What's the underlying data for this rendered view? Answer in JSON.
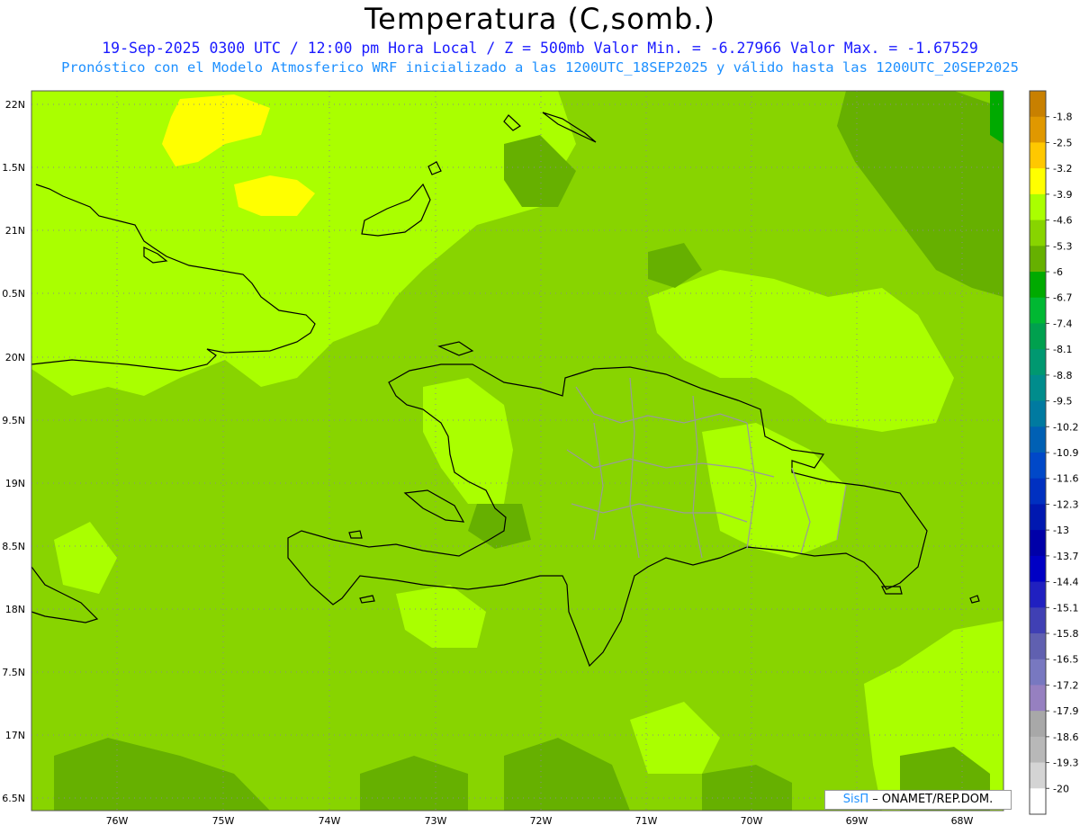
{
  "title": "Temperatura (C,somb.)",
  "subtitle_line1": "19-Sep-2025 0300 UTC / 12:00 pm Hora Local / Z = 500mb Valor Min. = -6.27966 Valor Max. = -1.67529",
  "subtitle_line2": "Pronóstico con el Modelo Atmosferico WRF inicializado a las 1200UTC_18SEP2025 y válido hasta las 1200UTC_20SEP2025",
  "credit": {
    "brand": "SisΠ",
    "text": "– ONAMET/REP.DOM."
  },
  "lat_labels": [
    "22N",
    "1.5N",
    "21N",
    "0.5N",
    "20N",
    "9.5N",
    "19N",
    "8.5N",
    "18N",
    "7.5N",
    "17N",
    "6.5N"
  ],
  "lon_labels": [
    "76W",
    "75W",
    "74W",
    "73W",
    "72W",
    "71W",
    "70W",
    "69W",
    "68W"
  ],
  "colorbar": {
    "labels": [
      "-1.8",
      "-2.5",
      "-3.2",
      "-3.9",
      "-4.6",
      "-5.3",
      "-6",
      "-6.7",
      "-7.4",
      "-8.1",
      "-8.8",
      "-9.5",
      "-10.2",
      "-10.9",
      "-11.6",
      "-12.3",
      "-13",
      "-13.7",
      "-14.4",
      "-15.1",
      "-15.8",
      "-16.5",
      "-17.2",
      "-17.9",
      "-18.6",
      "-19.3",
      "-20"
    ],
    "colors": [
      "#c88000",
      "#e09800",
      "#ffc800",
      "#ffff00",
      "#aaff00",
      "#88d400",
      "#66b000",
      "#00aa00",
      "#00b832",
      "#00a04e",
      "#009870",
      "#008c8c",
      "#007aa0",
      "#0060b4",
      "#0048c8",
      "#0030c0",
      "#0018b0",
      "#0000a8",
      "#0000c4",
      "#2020c0",
      "#4040b4",
      "#6060b0",
      "#7878c0",
      "#9680c0",
      "#a8a8a8",
      "#b8b8b8",
      "#d4d4d4",
      "#ffffff"
    ]
  },
  "fill_colors": {
    "light": "#aaff00",
    "mid": "#88d400",
    "dark": "#66b000",
    "yellow": "#ffff00",
    "green": "#00aa00"
  }
}
